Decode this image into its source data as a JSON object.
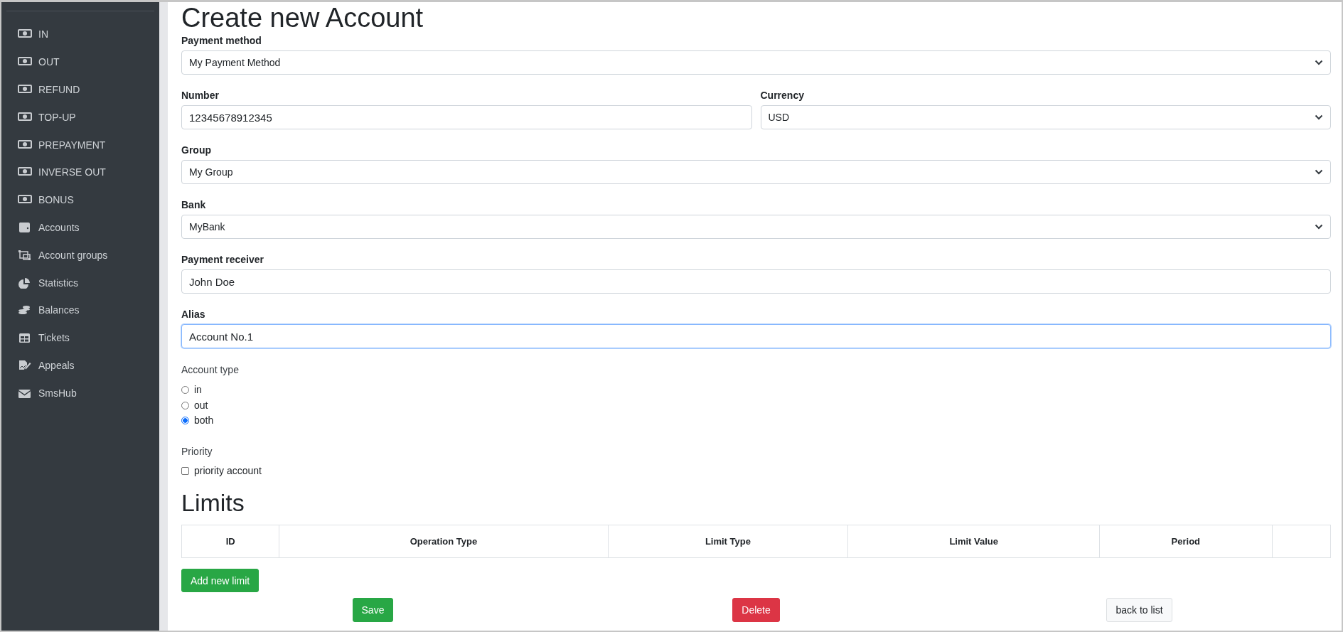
{
  "sidebar": {
    "items": [
      {
        "label": "IN",
        "kind": "operation"
      },
      {
        "label": "OUT",
        "kind": "operation"
      },
      {
        "label": "REFUND",
        "kind": "operation"
      },
      {
        "label": "TOP-UP",
        "kind": "operation"
      },
      {
        "label": "PREPAYMENT",
        "kind": "operation"
      },
      {
        "label": "INVERSE OUT",
        "kind": "operation"
      },
      {
        "label": "BONUS",
        "kind": "operation"
      },
      {
        "label": "Accounts",
        "kind": "wallet"
      },
      {
        "label": "Account groups",
        "kind": "group"
      },
      {
        "label": "Statistics",
        "kind": "pie"
      },
      {
        "label": "Balances",
        "kind": "coins"
      },
      {
        "label": "Tickets",
        "kind": "table"
      },
      {
        "label": "Appeals",
        "kind": "sign"
      },
      {
        "label": "SmsHub",
        "kind": "mail"
      }
    ]
  },
  "page_title": "Create new Account",
  "form": {
    "rows": [
      [
        {
          "label": "Payment method",
          "kind": "select",
          "value": "My Payment Method",
          "focused": false
        }
      ],
      [
        {
          "label": "Number",
          "kind": "input",
          "value": "12345678912345",
          "focused": false
        },
        {
          "label": "Currency",
          "kind": "select",
          "value": "USD",
          "focused": false
        }
      ],
      [
        {
          "label": "Group",
          "kind": "select",
          "value": "My Group",
          "focused": false
        }
      ],
      [
        {
          "label": "Bank",
          "kind": "select",
          "value": "MyBank",
          "focused": false
        }
      ],
      [
        {
          "label": "Payment receiver",
          "kind": "input",
          "value": "John Doe",
          "focused": false
        }
      ],
      [
        {
          "label": "Alias",
          "kind": "input",
          "value": "Account No.1",
          "focused": true
        }
      ]
    ],
    "account_type": {
      "label": "Account type",
      "options": [
        {
          "label": "in",
          "selected": false
        },
        {
          "label": "out",
          "selected": false
        },
        {
          "label": "both",
          "selected": true
        }
      ]
    },
    "priority": {
      "label": "Priority",
      "options": [
        {
          "label": "priority account",
          "checked": false
        }
      ]
    }
  },
  "limits": {
    "title": "Limits",
    "columns": [
      "ID",
      "Operation Type",
      "Limit Type",
      "Limit Value",
      "Period"
    ],
    "add_button": "Add new limit"
  },
  "actions": [
    {
      "label": "Save",
      "kind": "success"
    },
    {
      "label": "Delete",
      "kind": "danger"
    },
    {
      "label": "back to list",
      "kind": "light"
    }
  ]
}
